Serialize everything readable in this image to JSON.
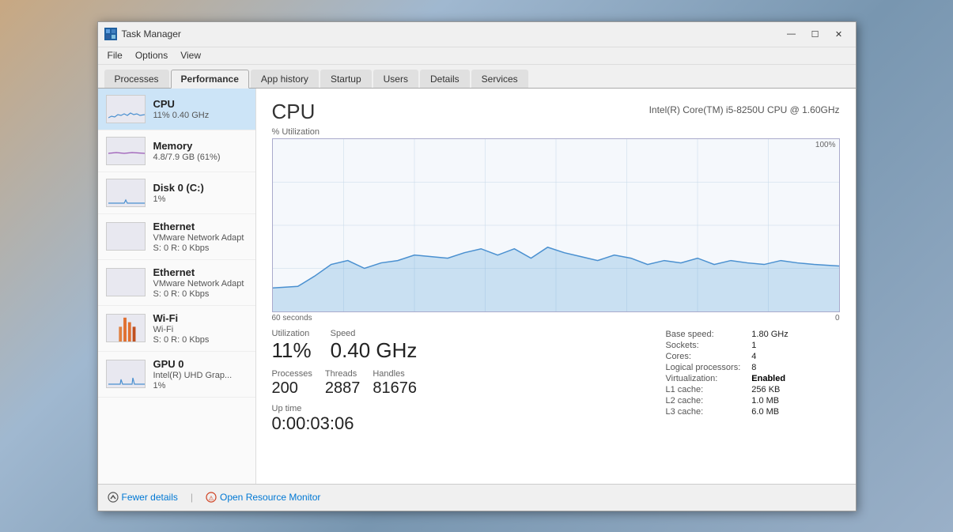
{
  "window": {
    "title": "Task Manager",
    "icon": "TM"
  },
  "titlebar": {
    "minimize": "—",
    "restore": "☐",
    "close": "✕"
  },
  "menubar": {
    "items": [
      "File",
      "Options",
      "View"
    ]
  },
  "tabs": [
    {
      "label": "Processes",
      "active": false
    },
    {
      "label": "Performance",
      "active": true
    },
    {
      "label": "App history",
      "active": false
    },
    {
      "label": "Startup",
      "active": false
    },
    {
      "label": "Users",
      "active": false
    },
    {
      "label": "Details",
      "active": false
    },
    {
      "label": "Services",
      "active": false
    }
  ],
  "sidebar": {
    "items": [
      {
        "id": "cpu",
        "label": "CPU",
        "sub1": "11% 0.40 GHz",
        "sub2": "",
        "active": true
      },
      {
        "id": "memory",
        "label": "Memory",
        "sub1": "4.8/7.9 GB (61%)",
        "sub2": "",
        "active": false
      },
      {
        "id": "disk",
        "label": "Disk 0 (C:)",
        "sub1": "1%",
        "sub2": "",
        "active": false
      },
      {
        "id": "ethernet1",
        "label": "Ethernet",
        "sub1": "VMware Network Adapt",
        "sub2": "S: 0 R: 0 Kbps",
        "active": false
      },
      {
        "id": "ethernet2",
        "label": "Ethernet",
        "sub1": "VMware Network Adapt",
        "sub2": "S: 0 R: 0 Kbps",
        "active": false
      },
      {
        "id": "wifi",
        "label": "Wi-Fi",
        "sub1": "Wi-Fi",
        "sub2": "S: 0 R: 0 Kbps",
        "active": false
      },
      {
        "id": "gpu",
        "label": "GPU 0",
        "sub1": "Intel(R) UHD Grap...",
        "sub2": "1%",
        "active": false
      }
    ]
  },
  "main": {
    "title": "CPU",
    "model": "Intel(R) Core(TM) i5-8250U CPU @ 1.60GHz",
    "chart": {
      "y_label": "% Utilization",
      "y_max": "100%",
      "y_min": "0",
      "x_left": "60 seconds",
      "x_right": "0"
    },
    "stats": {
      "utilization_label": "Utilization",
      "utilization_value": "11%",
      "speed_label": "Speed",
      "speed_value": "0.40 GHz",
      "processes_label": "Processes",
      "processes_value": "200",
      "threads_label": "Threads",
      "threads_value": "2887",
      "handles_label": "Handles",
      "handles_value": "81676",
      "uptime_label": "Up time",
      "uptime_value": "0:00:03:06"
    },
    "specs": {
      "base_speed_label": "Base speed:",
      "base_speed_value": "1.80 GHz",
      "sockets_label": "Sockets:",
      "sockets_value": "1",
      "cores_label": "Cores:",
      "cores_value": "4",
      "logical_label": "Logical processors:",
      "logical_value": "8",
      "virtualization_label": "Virtualization:",
      "virtualization_value": "Enabled",
      "l1_label": "L1 cache:",
      "l1_value": "256 KB",
      "l2_label": "L2 cache:",
      "l2_value": "1.0 MB",
      "l3_label": "L3 cache:",
      "l3_value": "6.0 MB"
    }
  },
  "footer": {
    "fewer_details": "Fewer details",
    "separator": "|",
    "resource_monitor": "Open Resource Monitor"
  },
  "colors": {
    "chart_line": "#4a90d0",
    "chart_fill": "rgba(100,180,230,0.3)",
    "active_tab_bg": "#f0f0f0",
    "active_sidebar_bg": "#cce4f7",
    "accent": "#0078d4"
  }
}
